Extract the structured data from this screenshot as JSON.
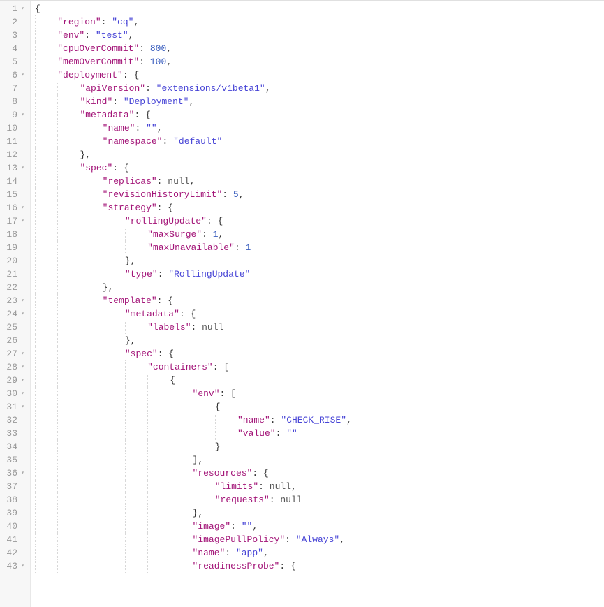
{
  "startLine": 1,
  "lines": [
    {
      "n": 1,
      "fold": true,
      "indent": 0,
      "tokens": [
        {
          "t": "punc",
          "v": "{"
        }
      ]
    },
    {
      "n": 2,
      "fold": false,
      "indent": 1,
      "tokens": [
        {
          "t": "key",
          "v": "\"region\""
        },
        {
          "t": "punc",
          "v": ": "
        },
        {
          "t": "str",
          "v": "\"cq\""
        },
        {
          "t": "punc",
          "v": ","
        }
      ]
    },
    {
      "n": 3,
      "fold": false,
      "indent": 1,
      "tokens": [
        {
          "t": "key",
          "v": "\"env\""
        },
        {
          "t": "punc",
          "v": ": "
        },
        {
          "t": "str",
          "v": "\"test\""
        },
        {
          "t": "punc",
          "v": ","
        }
      ]
    },
    {
      "n": 4,
      "fold": false,
      "indent": 1,
      "tokens": [
        {
          "t": "key",
          "v": "\"cpuOverCommit\""
        },
        {
          "t": "punc",
          "v": ": "
        },
        {
          "t": "num",
          "v": "800"
        },
        {
          "t": "punc",
          "v": ","
        }
      ]
    },
    {
      "n": 5,
      "fold": false,
      "indent": 1,
      "tokens": [
        {
          "t": "key",
          "v": "\"memOverCommit\""
        },
        {
          "t": "punc",
          "v": ": "
        },
        {
          "t": "num",
          "v": "100"
        },
        {
          "t": "punc",
          "v": ","
        }
      ]
    },
    {
      "n": 6,
      "fold": true,
      "indent": 1,
      "tokens": [
        {
          "t": "key",
          "v": "\"deployment\""
        },
        {
          "t": "punc",
          "v": ": {"
        }
      ]
    },
    {
      "n": 7,
      "fold": false,
      "indent": 2,
      "tokens": [
        {
          "t": "key",
          "v": "\"apiVersion\""
        },
        {
          "t": "punc",
          "v": ": "
        },
        {
          "t": "str",
          "v": "\"extensions/v1beta1\""
        },
        {
          "t": "punc",
          "v": ","
        }
      ]
    },
    {
      "n": 8,
      "fold": false,
      "indent": 2,
      "tokens": [
        {
          "t": "key",
          "v": "\"kind\""
        },
        {
          "t": "punc",
          "v": ": "
        },
        {
          "t": "str",
          "v": "\"Deployment\""
        },
        {
          "t": "punc",
          "v": ","
        }
      ]
    },
    {
      "n": 9,
      "fold": true,
      "indent": 2,
      "tokens": [
        {
          "t": "key",
          "v": "\"metadata\""
        },
        {
          "t": "punc",
          "v": ": {"
        }
      ]
    },
    {
      "n": 10,
      "fold": false,
      "indent": 3,
      "tokens": [
        {
          "t": "key",
          "v": "\"name\""
        },
        {
          "t": "punc",
          "v": ": "
        },
        {
          "t": "str",
          "v": "\"\""
        },
        {
          "t": "punc",
          "v": ","
        }
      ]
    },
    {
      "n": 11,
      "fold": false,
      "indent": 3,
      "tokens": [
        {
          "t": "key",
          "v": "\"namespace\""
        },
        {
          "t": "punc",
          "v": ": "
        },
        {
          "t": "str",
          "v": "\"default\""
        }
      ]
    },
    {
      "n": 12,
      "fold": false,
      "indent": 2,
      "tokens": [
        {
          "t": "punc",
          "v": "},"
        }
      ]
    },
    {
      "n": 13,
      "fold": true,
      "indent": 2,
      "tokens": [
        {
          "t": "key",
          "v": "\"spec\""
        },
        {
          "t": "punc",
          "v": ": {"
        }
      ]
    },
    {
      "n": 14,
      "fold": false,
      "indent": 3,
      "tokens": [
        {
          "t": "key",
          "v": "\"replicas\""
        },
        {
          "t": "punc",
          "v": ": "
        },
        {
          "t": "null",
          "v": "null"
        },
        {
          "t": "punc",
          "v": ","
        }
      ]
    },
    {
      "n": 15,
      "fold": false,
      "indent": 3,
      "tokens": [
        {
          "t": "key",
          "v": "\"revisionHistoryLimit\""
        },
        {
          "t": "punc",
          "v": ": "
        },
        {
          "t": "num",
          "v": "5"
        },
        {
          "t": "punc",
          "v": ","
        }
      ]
    },
    {
      "n": 16,
      "fold": true,
      "indent": 3,
      "tokens": [
        {
          "t": "key",
          "v": "\"strategy\""
        },
        {
          "t": "punc",
          "v": ": {"
        }
      ]
    },
    {
      "n": 17,
      "fold": true,
      "indent": 4,
      "tokens": [
        {
          "t": "key",
          "v": "\"rollingUpdate\""
        },
        {
          "t": "punc",
          "v": ": {"
        }
      ]
    },
    {
      "n": 18,
      "fold": false,
      "indent": 5,
      "tokens": [
        {
          "t": "key",
          "v": "\"maxSurge\""
        },
        {
          "t": "punc",
          "v": ": "
        },
        {
          "t": "num",
          "v": "1"
        },
        {
          "t": "punc",
          "v": ","
        }
      ]
    },
    {
      "n": 19,
      "fold": false,
      "indent": 5,
      "tokens": [
        {
          "t": "key",
          "v": "\"maxUnavailable\""
        },
        {
          "t": "punc",
          "v": ": "
        },
        {
          "t": "num",
          "v": "1"
        }
      ]
    },
    {
      "n": 20,
      "fold": false,
      "indent": 4,
      "tokens": [
        {
          "t": "punc",
          "v": "},"
        }
      ]
    },
    {
      "n": 21,
      "fold": false,
      "indent": 4,
      "tokens": [
        {
          "t": "key",
          "v": "\"type\""
        },
        {
          "t": "punc",
          "v": ": "
        },
        {
          "t": "str",
          "v": "\"RollingUpdate\""
        }
      ]
    },
    {
      "n": 22,
      "fold": false,
      "indent": 3,
      "tokens": [
        {
          "t": "punc",
          "v": "},"
        }
      ]
    },
    {
      "n": 23,
      "fold": true,
      "indent": 3,
      "tokens": [
        {
          "t": "key",
          "v": "\"template\""
        },
        {
          "t": "punc",
          "v": ": {"
        }
      ]
    },
    {
      "n": 24,
      "fold": true,
      "indent": 4,
      "tokens": [
        {
          "t": "key",
          "v": "\"metadata\""
        },
        {
          "t": "punc",
          "v": ": {"
        }
      ]
    },
    {
      "n": 25,
      "fold": false,
      "indent": 5,
      "tokens": [
        {
          "t": "key",
          "v": "\"labels\""
        },
        {
          "t": "punc",
          "v": ": "
        },
        {
          "t": "null",
          "v": "null"
        }
      ]
    },
    {
      "n": 26,
      "fold": false,
      "indent": 4,
      "tokens": [
        {
          "t": "punc",
          "v": "},"
        }
      ]
    },
    {
      "n": 27,
      "fold": true,
      "indent": 4,
      "tokens": [
        {
          "t": "key",
          "v": "\"spec\""
        },
        {
          "t": "punc",
          "v": ": {"
        }
      ]
    },
    {
      "n": 28,
      "fold": true,
      "indent": 5,
      "tokens": [
        {
          "t": "key",
          "v": "\"containers\""
        },
        {
          "t": "punc",
          "v": ": ["
        }
      ]
    },
    {
      "n": 29,
      "fold": true,
      "indent": 6,
      "tokens": [
        {
          "t": "punc",
          "v": "{"
        }
      ]
    },
    {
      "n": 30,
      "fold": true,
      "indent": 7,
      "tokens": [
        {
          "t": "key",
          "v": "\"env\""
        },
        {
          "t": "punc",
          "v": ": ["
        }
      ]
    },
    {
      "n": 31,
      "fold": true,
      "indent": 8,
      "tokens": [
        {
          "t": "punc",
          "v": "{"
        }
      ]
    },
    {
      "n": 32,
      "fold": false,
      "indent": 9,
      "tokens": [
        {
          "t": "key",
          "v": "\"name\""
        },
        {
          "t": "punc",
          "v": ": "
        },
        {
          "t": "str",
          "v": "\"CHECK_RISE\""
        },
        {
          "t": "punc",
          "v": ","
        }
      ]
    },
    {
      "n": 33,
      "fold": false,
      "indent": 9,
      "tokens": [
        {
          "t": "key",
          "v": "\"value\""
        },
        {
          "t": "punc",
          "v": ": "
        },
        {
          "t": "str",
          "v": "\"\""
        }
      ]
    },
    {
      "n": 34,
      "fold": false,
      "indent": 8,
      "tokens": [
        {
          "t": "punc",
          "v": "}"
        }
      ]
    },
    {
      "n": 35,
      "fold": false,
      "indent": 7,
      "tokens": [
        {
          "t": "punc",
          "v": "],"
        }
      ]
    },
    {
      "n": 36,
      "fold": true,
      "indent": 7,
      "tokens": [
        {
          "t": "key",
          "v": "\"resources\""
        },
        {
          "t": "punc",
          "v": ": {"
        }
      ]
    },
    {
      "n": 37,
      "fold": false,
      "indent": 8,
      "tokens": [
        {
          "t": "key",
          "v": "\"limits\""
        },
        {
          "t": "punc",
          "v": ": "
        },
        {
          "t": "null",
          "v": "null"
        },
        {
          "t": "punc",
          "v": ","
        }
      ]
    },
    {
      "n": 38,
      "fold": false,
      "indent": 8,
      "tokens": [
        {
          "t": "key",
          "v": "\"requests\""
        },
        {
          "t": "punc",
          "v": ": "
        },
        {
          "t": "null",
          "v": "null"
        }
      ]
    },
    {
      "n": 39,
      "fold": false,
      "indent": 7,
      "tokens": [
        {
          "t": "punc",
          "v": "},"
        }
      ]
    },
    {
      "n": 40,
      "fold": false,
      "indent": 7,
      "tokens": [
        {
          "t": "key",
          "v": "\"image\""
        },
        {
          "t": "punc",
          "v": ": "
        },
        {
          "t": "str",
          "v": "\"\""
        },
        {
          "t": "punc",
          "v": ","
        }
      ]
    },
    {
      "n": 41,
      "fold": false,
      "indent": 7,
      "tokens": [
        {
          "t": "key",
          "v": "\"imagePullPolicy\""
        },
        {
          "t": "punc",
          "v": ": "
        },
        {
          "t": "str",
          "v": "\"Always\""
        },
        {
          "t": "punc",
          "v": ","
        }
      ]
    },
    {
      "n": 42,
      "fold": false,
      "indent": 7,
      "tokens": [
        {
          "t": "key",
          "v": "\"name\""
        },
        {
          "t": "punc",
          "v": ": "
        },
        {
          "t": "str",
          "v": "\"app\""
        },
        {
          "t": "punc",
          "v": ","
        }
      ]
    },
    {
      "n": 43,
      "fold": true,
      "indent": 7,
      "tokens": [
        {
          "t": "key",
          "v": "\"readinessProbe\""
        },
        {
          "t": "punc",
          "v": ": {"
        }
      ]
    }
  ]
}
